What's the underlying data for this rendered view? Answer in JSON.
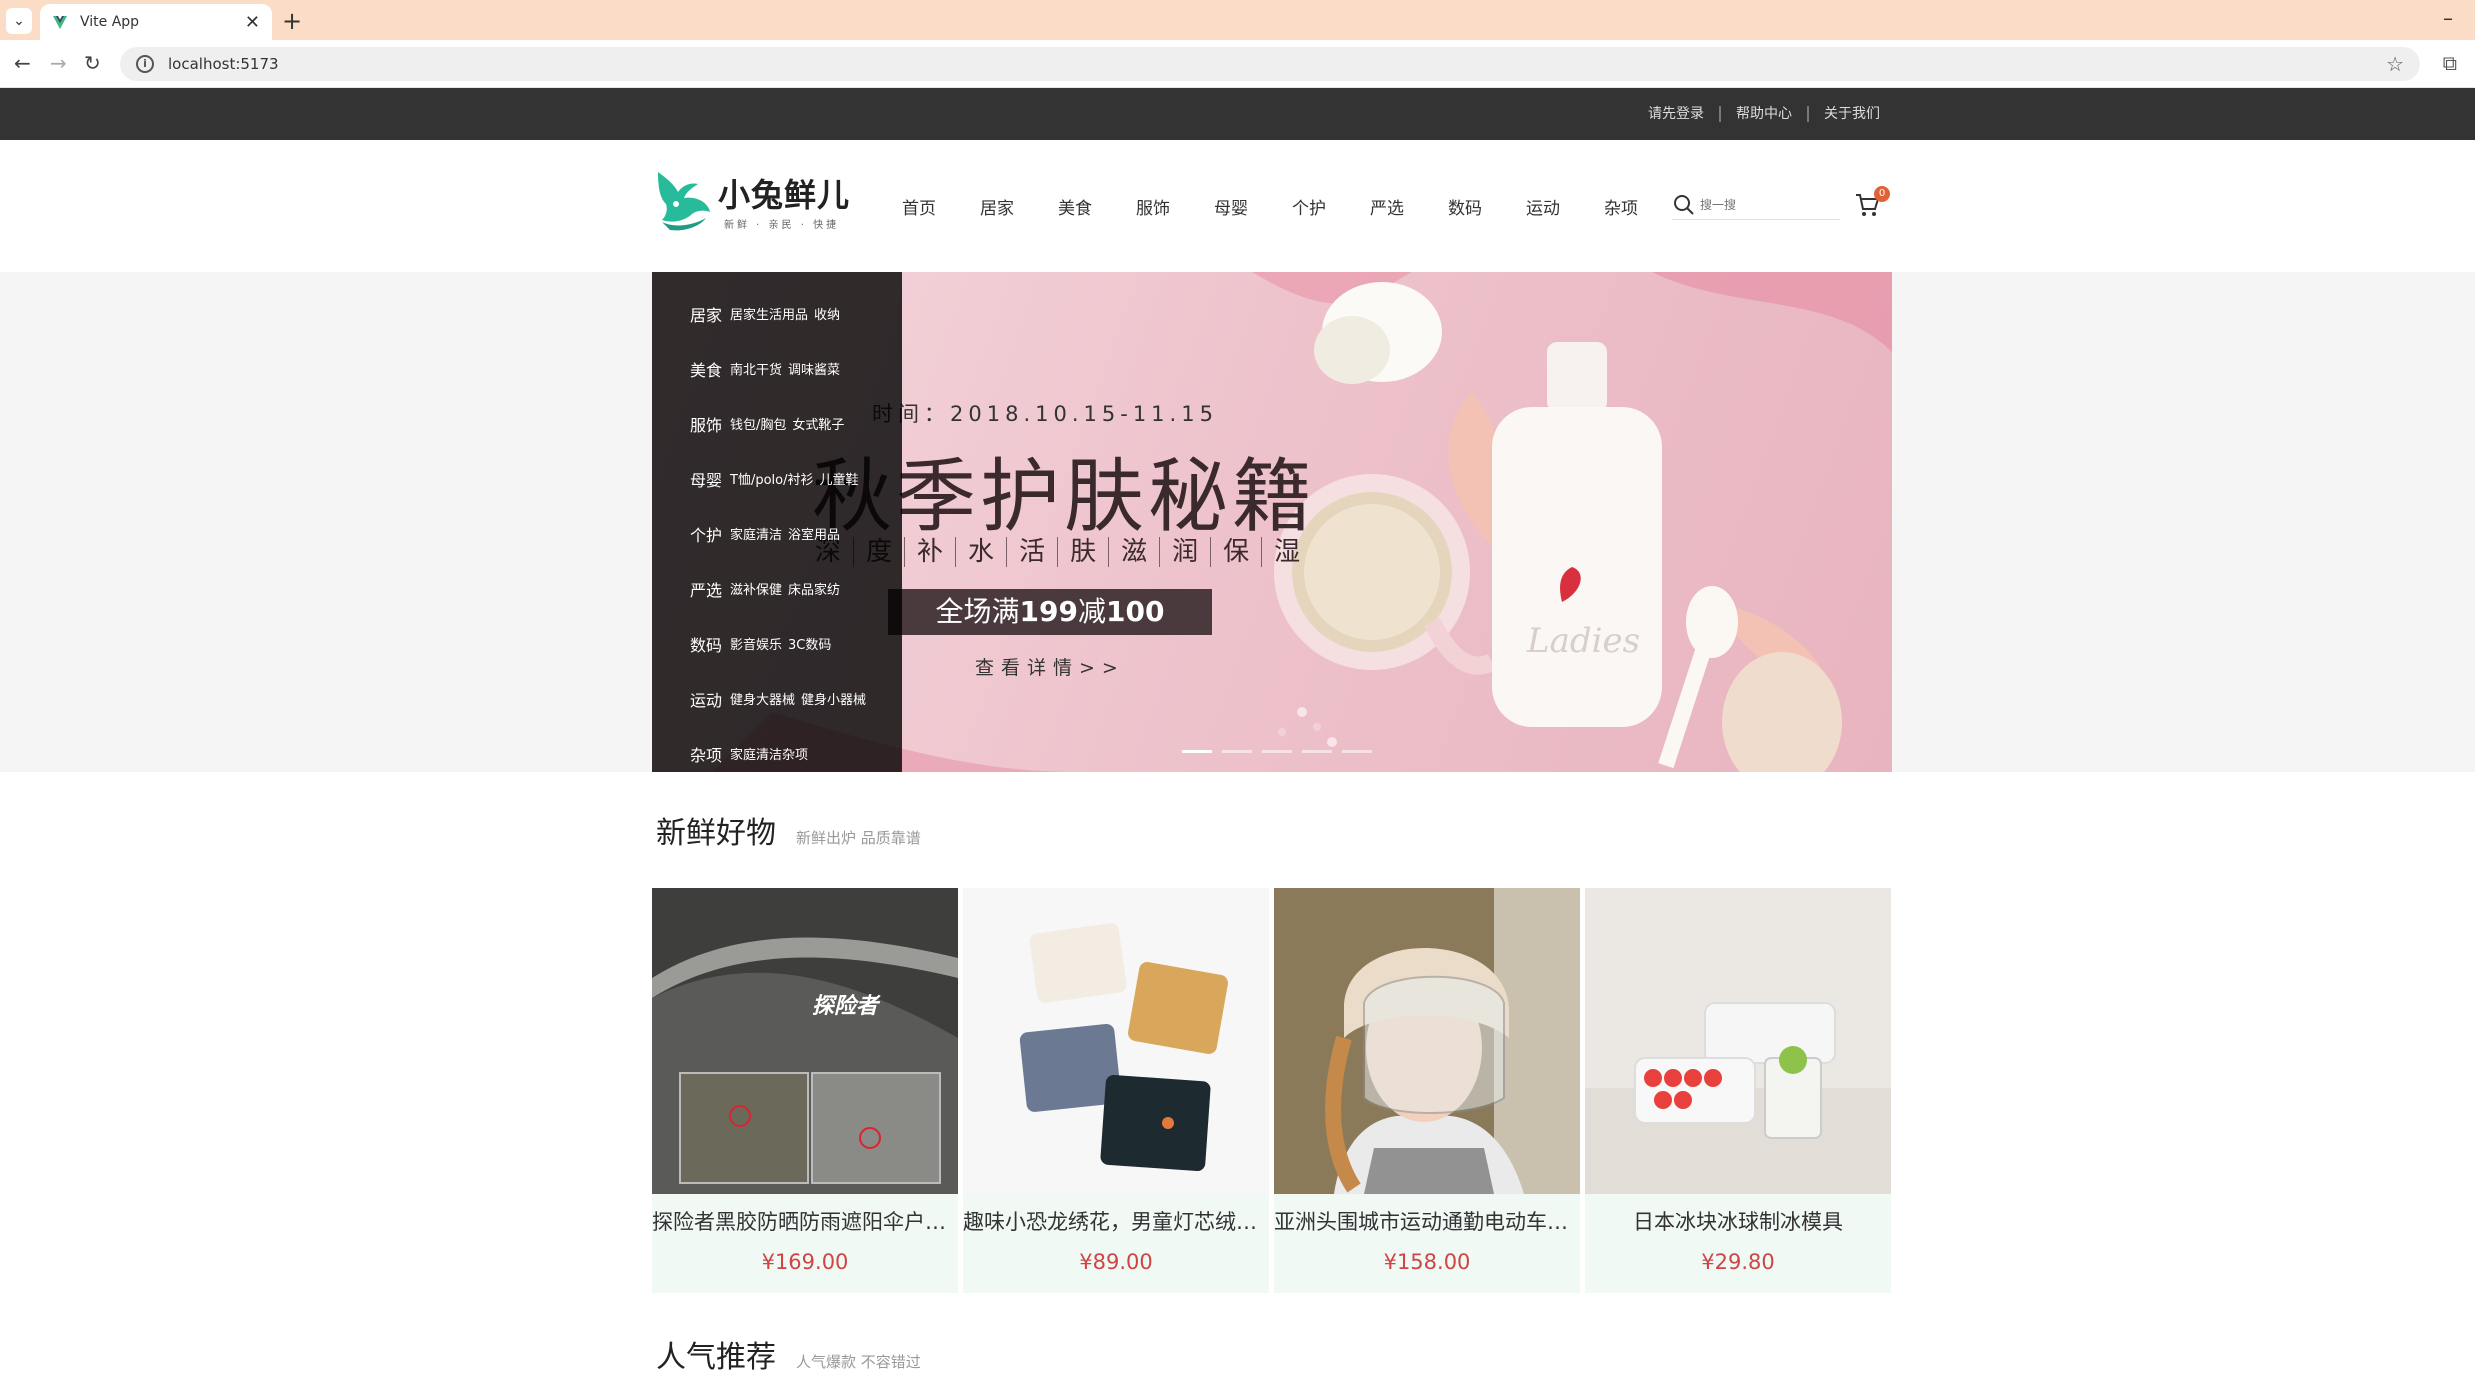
{
  "browser": {
    "tab_title": "Vite App",
    "url": "localhost:5173"
  },
  "topnav": {
    "links": [
      "请先登录",
      "帮助中心",
      "关于我们"
    ]
  },
  "header": {
    "brand": "小兔鲜儿",
    "slogan": "新鲜 · 亲民 · 快捷",
    "nav": [
      "首页",
      "居家",
      "美食",
      "服饰",
      "母婴",
      "个护",
      "严选",
      "数码",
      "运动",
      "杂项"
    ],
    "search_placeholder": "搜一搜",
    "cart_count": "0"
  },
  "categories": [
    {
      "name": "居家",
      "subs": [
        "居家生活用品",
        "收纳"
      ]
    },
    {
      "name": "美食",
      "subs": [
        "南北干货",
        "调味酱菜"
      ]
    },
    {
      "name": "服饰",
      "subs": [
        "钱包/胸包",
        "女式靴子"
      ]
    },
    {
      "name": "母婴",
      "subs": [
        "T恤/polo/衬衫",
        "儿童鞋"
      ]
    },
    {
      "name": "个护",
      "subs": [
        "家庭清洁",
        "浴室用品"
      ]
    },
    {
      "name": "严选",
      "subs": [
        "滋补保健",
        "床品家纺"
      ]
    },
    {
      "name": "数码",
      "subs": [
        "影音娱乐",
        "3C数码"
      ]
    },
    {
      "name": "运动",
      "subs": [
        "健身大器械",
        "健身小器械"
      ]
    },
    {
      "name": "杂项",
      "subs": [
        "家庭清洁杂项"
      ]
    }
  ],
  "banner": {
    "date": "时间：2018.10.15-11.15",
    "title": "秋季护肤秘籍",
    "subtitle": [
      "深",
      "度",
      "补",
      "水",
      "活",
      "肤",
      "滋",
      "润",
      "保",
      "湿"
    ],
    "deal_prefix": "全场满",
    "deal_a": "199",
    "deal_mid": "减",
    "deal_b": "100",
    "link": "查看详情>>",
    "bottle_label": "Ladies"
  },
  "new_goods": {
    "title": "新鲜好物",
    "subtitle": "新鲜出炉 品质靠谱",
    "items": [
      {
        "name": "探险者黑胶防晒防雨遮阳伞户外折叠伞",
        "price": "¥169.00",
        "image_text": "探险者"
      },
      {
        "name": "趣味小恐龙绣花，男童灯芯绒衬衫",
        "price": "¥89.00"
      },
      {
        "name": "亚洲头围城市运动通勤电动车头盔",
        "price": "¥158.00"
      },
      {
        "name": "日本冰块冰球制冰模具",
        "price": "¥29.80"
      }
    ]
  },
  "popular": {
    "title": "人气推荐",
    "subtitle": "人气爆款 不容错过"
  }
}
